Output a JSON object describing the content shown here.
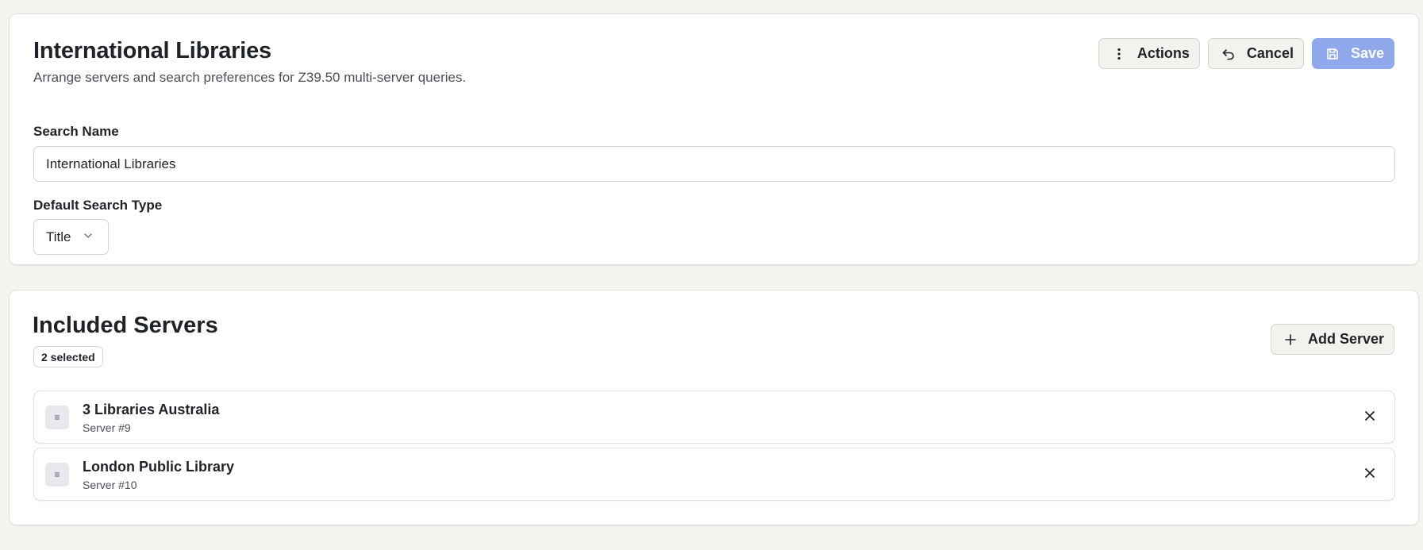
{
  "header": {
    "title": "International Libraries",
    "subtitle": "Arrange servers and search preferences for Z39.50 multi-server queries."
  },
  "toolbar": {
    "actions_label": "Actions",
    "cancel_label": "Cancel",
    "save_label": "Save",
    "actions_icon": "more-vertical-icon",
    "cancel_icon": "undo-icon",
    "save_icon": "save-icon"
  },
  "form": {
    "search_name_label": "Search Name",
    "search_name_value": "International Libraries",
    "search_type_label": "Default Search Type",
    "search_type_value": "Title"
  },
  "servers": {
    "title": "Included Servers",
    "selected_badge": "2 selected",
    "add_label": "Add Server",
    "items": [
      {
        "name": "3 Libraries Australia",
        "id": "Server #9"
      },
      {
        "name": "London Public Library",
        "id": "Server #10"
      }
    ]
  },
  "colors": {
    "page_background": "#f5f4f0",
    "card_background": "#ffffff",
    "primary_button": "#8fa9ec",
    "text": "#1f2328"
  }
}
